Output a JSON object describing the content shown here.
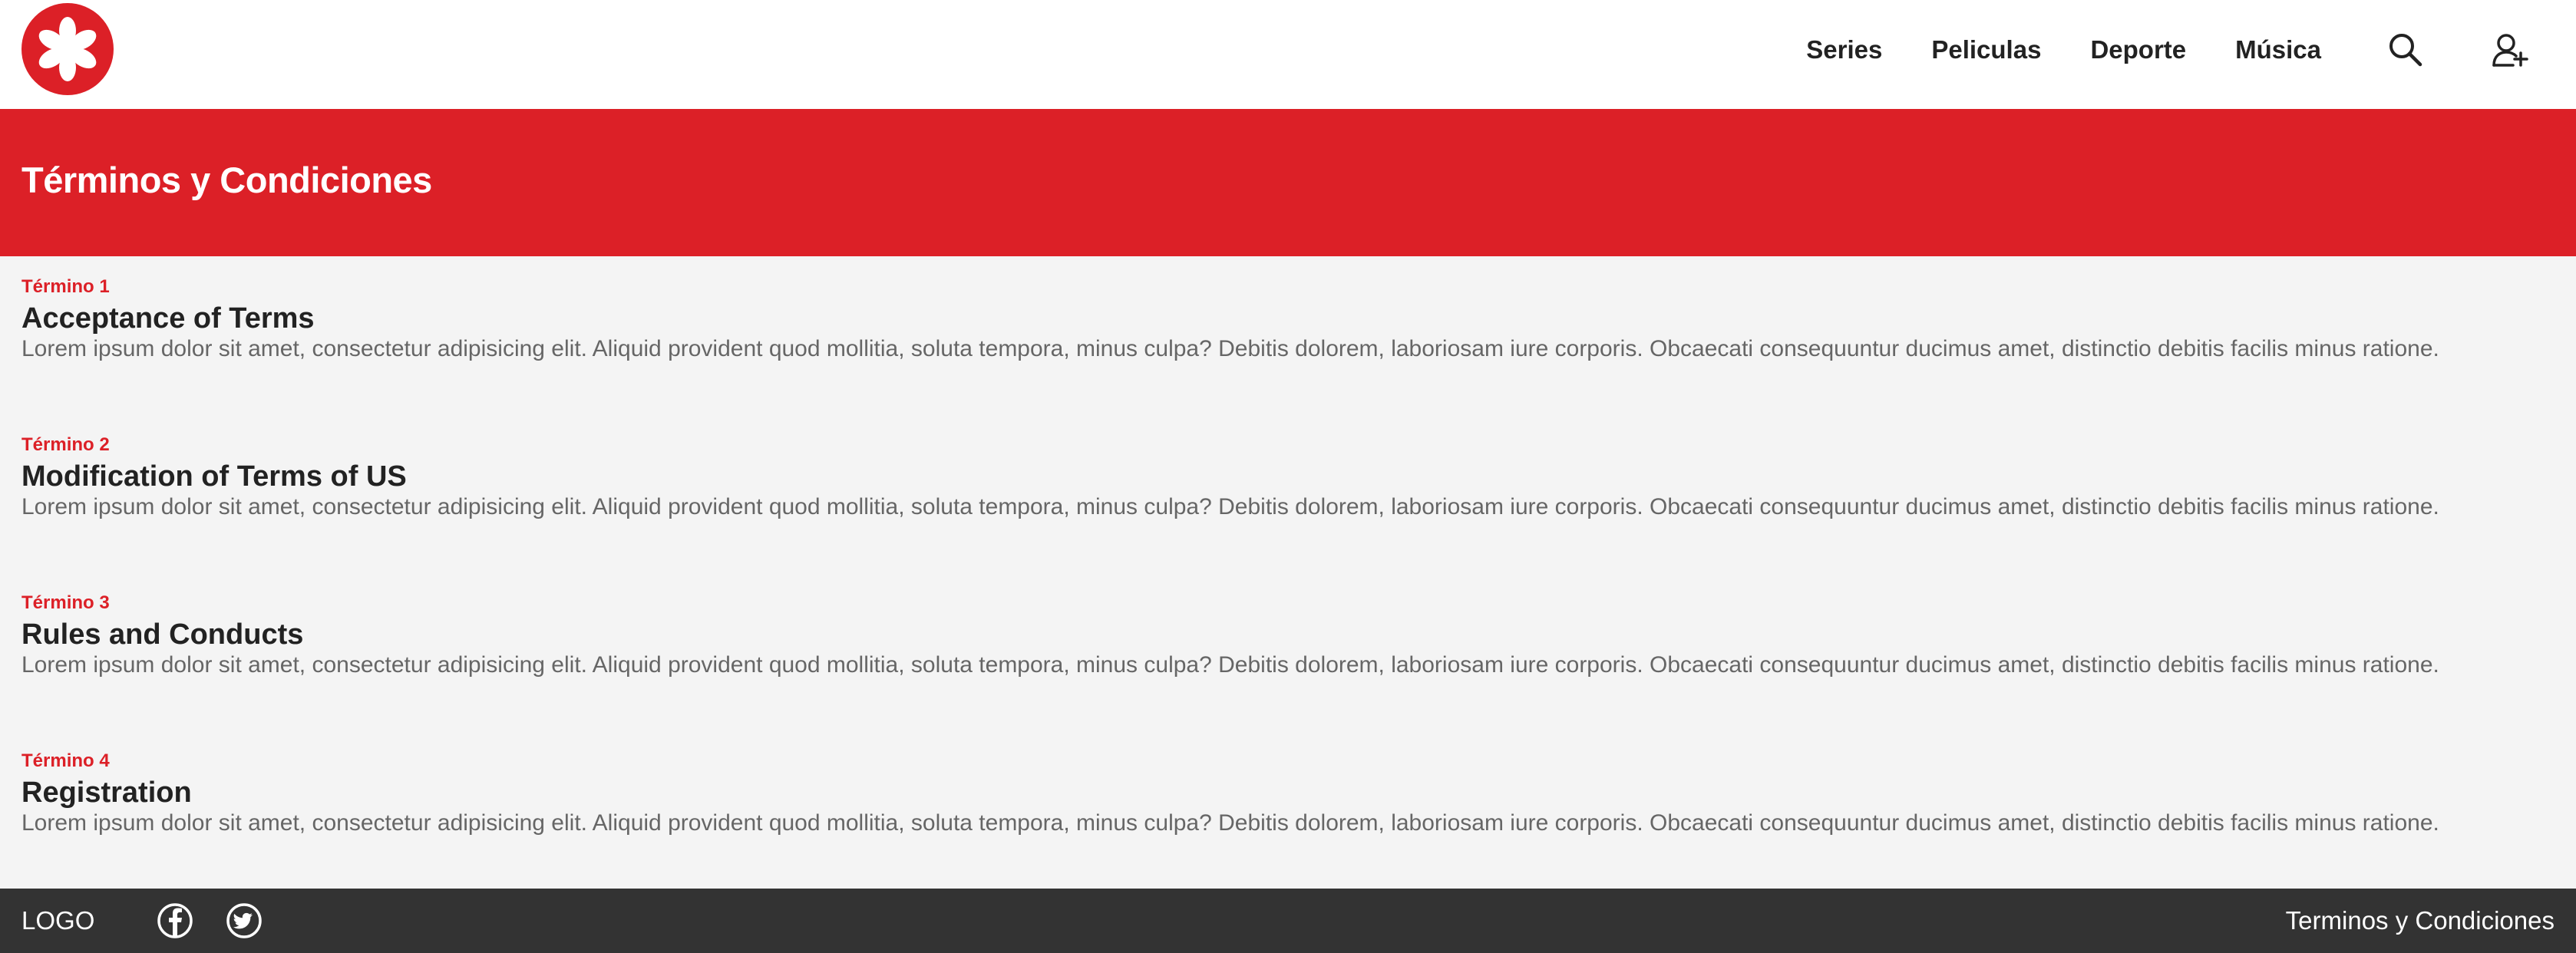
{
  "header": {
    "logo_icon": "flower-logo-icon",
    "nav": [
      "Series",
      "Peliculas",
      "Deporte",
      "Música"
    ],
    "search_icon": "search-icon",
    "user_icon": "add-user-icon"
  },
  "hero": {
    "title": "Términos y Condiciones"
  },
  "terms": [
    {
      "label": "Término 1",
      "heading": "Acceptance of Terms",
      "text": "Lorem ipsum dolor sit amet, consectetur adipisicing elit. Aliquid provident quod mollitia, soluta tempora, minus culpa? Debitis dolorem, laboriosam iure corporis. Obcaecati consequuntur ducimus amet, distinctio debitis facilis minus ratione."
    },
    {
      "label": "Término 2",
      "heading": "Modification of Terms of US",
      "text": "Lorem ipsum dolor sit amet, consectetur adipisicing elit. Aliquid provident quod mollitia, soluta tempora, minus culpa? Debitis dolorem, laboriosam iure corporis. Obcaecati consequuntur ducimus amet, distinctio debitis facilis minus ratione."
    },
    {
      "label": "Término 3",
      "heading": "Rules and Conducts",
      "text": "Lorem ipsum dolor sit amet, consectetur adipisicing elit. Aliquid provident quod mollitia, soluta tempora, minus culpa? Debitis dolorem, laboriosam iure corporis. Obcaecati consequuntur ducimus amet, distinctio debitis facilis minus ratione."
    },
    {
      "label": "Término 4",
      "heading": "Registration",
      "text": "Lorem ipsum dolor sit amet, consectetur adipisicing elit. Aliquid provident quod mollitia, soluta tempora, minus culpa? Debitis dolorem, laboriosam iure corporis. Obcaecati consequuntur ducimus amet, distinctio debitis facilis minus ratione."
    }
  ],
  "footer": {
    "logo": "LOGO",
    "social": [
      "facebook-icon",
      "twitter-icon"
    ],
    "link": "Terminos y Condiciones"
  },
  "colors": {
    "brand_red": "#dc2027",
    "header_bg": "#ffffff",
    "page_bg": "#f4f4f4",
    "footer_bg": "#333333",
    "heading_text": "#222222",
    "body_text": "#666666"
  }
}
